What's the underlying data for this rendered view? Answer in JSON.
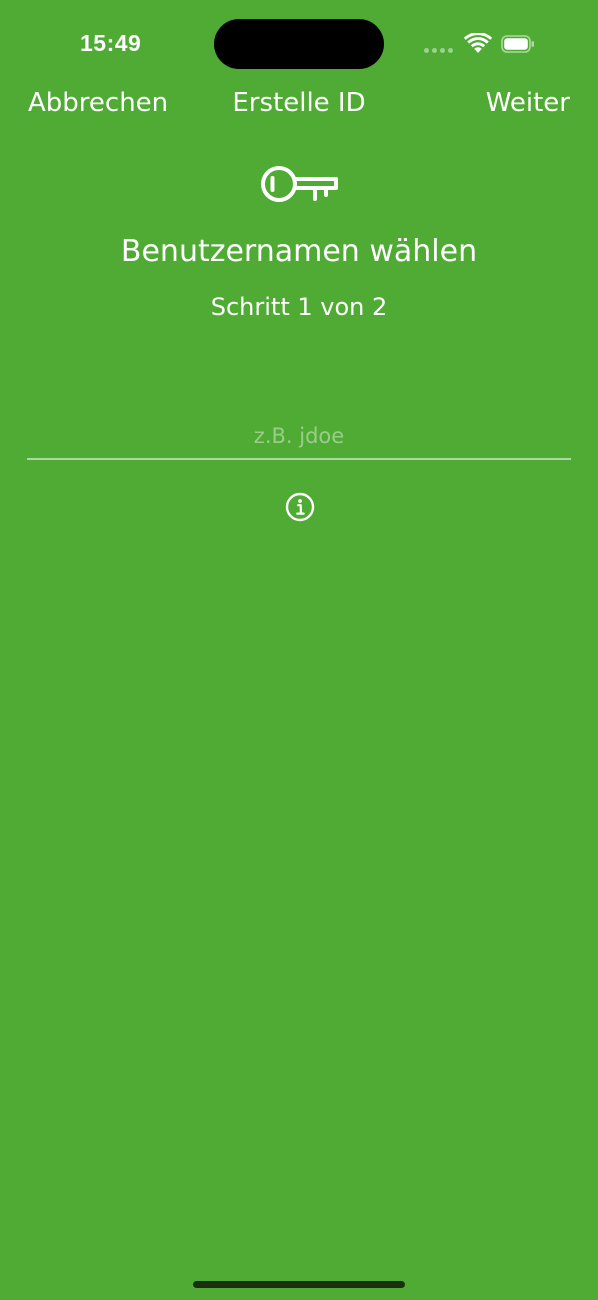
{
  "status_bar": {
    "time": "15:49",
    "wifi_icon": "wifi-icon",
    "battery_icon": "battery-icon",
    "signal_icon": "cellular-signal-icon"
  },
  "nav": {
    "cancel_label": "Abbrechen",
    "title": "Erstelle ID",
    "next_label": "Weiter"
  },
  "main": {
    "key_icon": "key-icon",
    "heading": "Benutzernamen wählen",
    "step": "Schritt 1 von 2",
    "username_field": {
      "value": "",
      "placeholder": "z.B. jdoe"
    },
    "info_icon": "info-icon"
  },
  "colors": {
    "background": "#4fab33",
    "foreground": "#ffffff",
    "home_indicator": "#1a2f12"
  }
}
